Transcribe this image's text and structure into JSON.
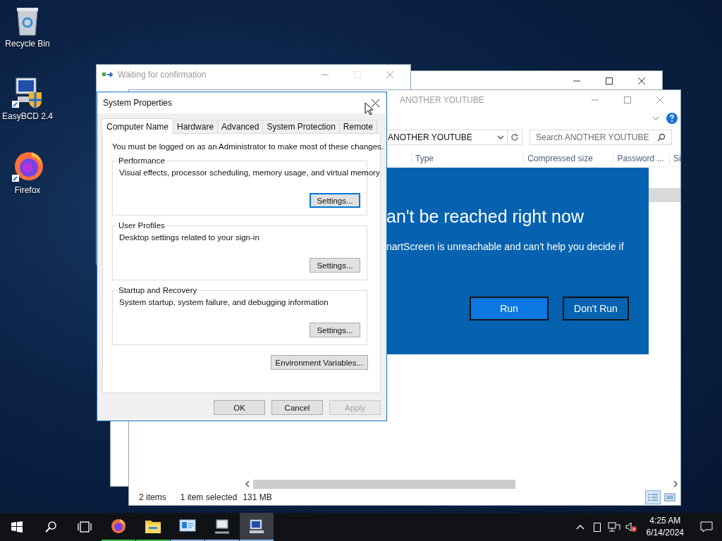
{
  "desktop_icons": [
    {
      "kind": "recycle",
      "label": "Recycle Bin"
    },
    {
      "kind": "easybcd",
      "label": "EasyBCD 2.4"
    },
    {
      "kind": "firefox",
      "label": "Firefox"
    }
  ],
  "waiting_window": {
    "title": "Waiting for confirmation"
  },
  "explorer": {
    "title": "ANOTHER YOUTUBE",
    "address": "ANOTHER YOUTUBE",
    "search_placeholder": "Search ANOTHER YOUTUBE",
    "columns": [
      "Type",
      "Compressed size",
      "Password ...",
      "Si"
    ],
    "rows": [
      {
        "selected": true
      },
      {
        "selected": false
      }
    ],
    "status": {
      "count": "2 items",
      "selection": "1 item selected",
      "size": "131 MB"
    },
    "views": [
      {
        "kind": "details",
        "selected": true
      },
      {
        "kind": "thumbnails",
        "selected": false
      }
    ]
  },
  "smartscreen": {
    "heading": "an't be reached right now",
    "message": "nartScreen is unreachable and can't help you decide if",
    "buttons": [
      "Run",
      "Don't Run"
    ]
  },
  "system_properties": {
    "title": "System Properties",
    "tabs": [
      {
        "label": "Computer Name",
        "selected": true
      },
      {
        "label": "Hardware",
        "selected": false
      },
      {
        "label": "Advanced",
        "selected": false
      },
      {
        "label": "System Protection",
        "selected": false
      },
      {
        "label": "Remote",
        "selected": false
      }
    ],
    "notice": "You must be logged on as an Administrator to make most of these changes.",
    "groups": [
      {
        "title": "Performance",
        "description": "Visual effects, processor scheduling, memory usage, and virtual memory",
        "button": "Settings...",
        "focused": true
      },
      {
        "title": "User Profiles",
        "description": "Desktop settings related to your sign-in",
        "button": "Settings...",
        "focused": false
      },
      {
        "title": "Startup and Recovery",
        "description": "System startup, system failure, and debugging information",
        "button": "Settings...",
        "focused": false
      }
    ],
    "env_button": "Environment Variables...",
    "buttons": [
      {
        "label": "OK",
        "disabled": false
      },
      {
        "label": "Cancel",
        "disabled": false
      },
      {
        "label": "Apply",
        "disabled": true
      }
    ]
  },
  "taskbar": {
    "apps": [
      {
        "kind": "firefox",
        "color": "#3fbf4f",
        "active": false
      },
      {
        "kind": "explorer",
        "color": "#3fbf4f",
        "active": false
      },
      {
        "kind": "control",
        "color": "#8fbbe8",
        "active": false
      },
      {
        "kind": "network",
        "color": "#8fbbe8",
        "active": false
      },
      {
        "kind": "system",
        "color": "#8fbbe8",
        "active": true
      }
    ],
    "time": "4:25 AM",
    "date": "6/14/2024"
  }
}
